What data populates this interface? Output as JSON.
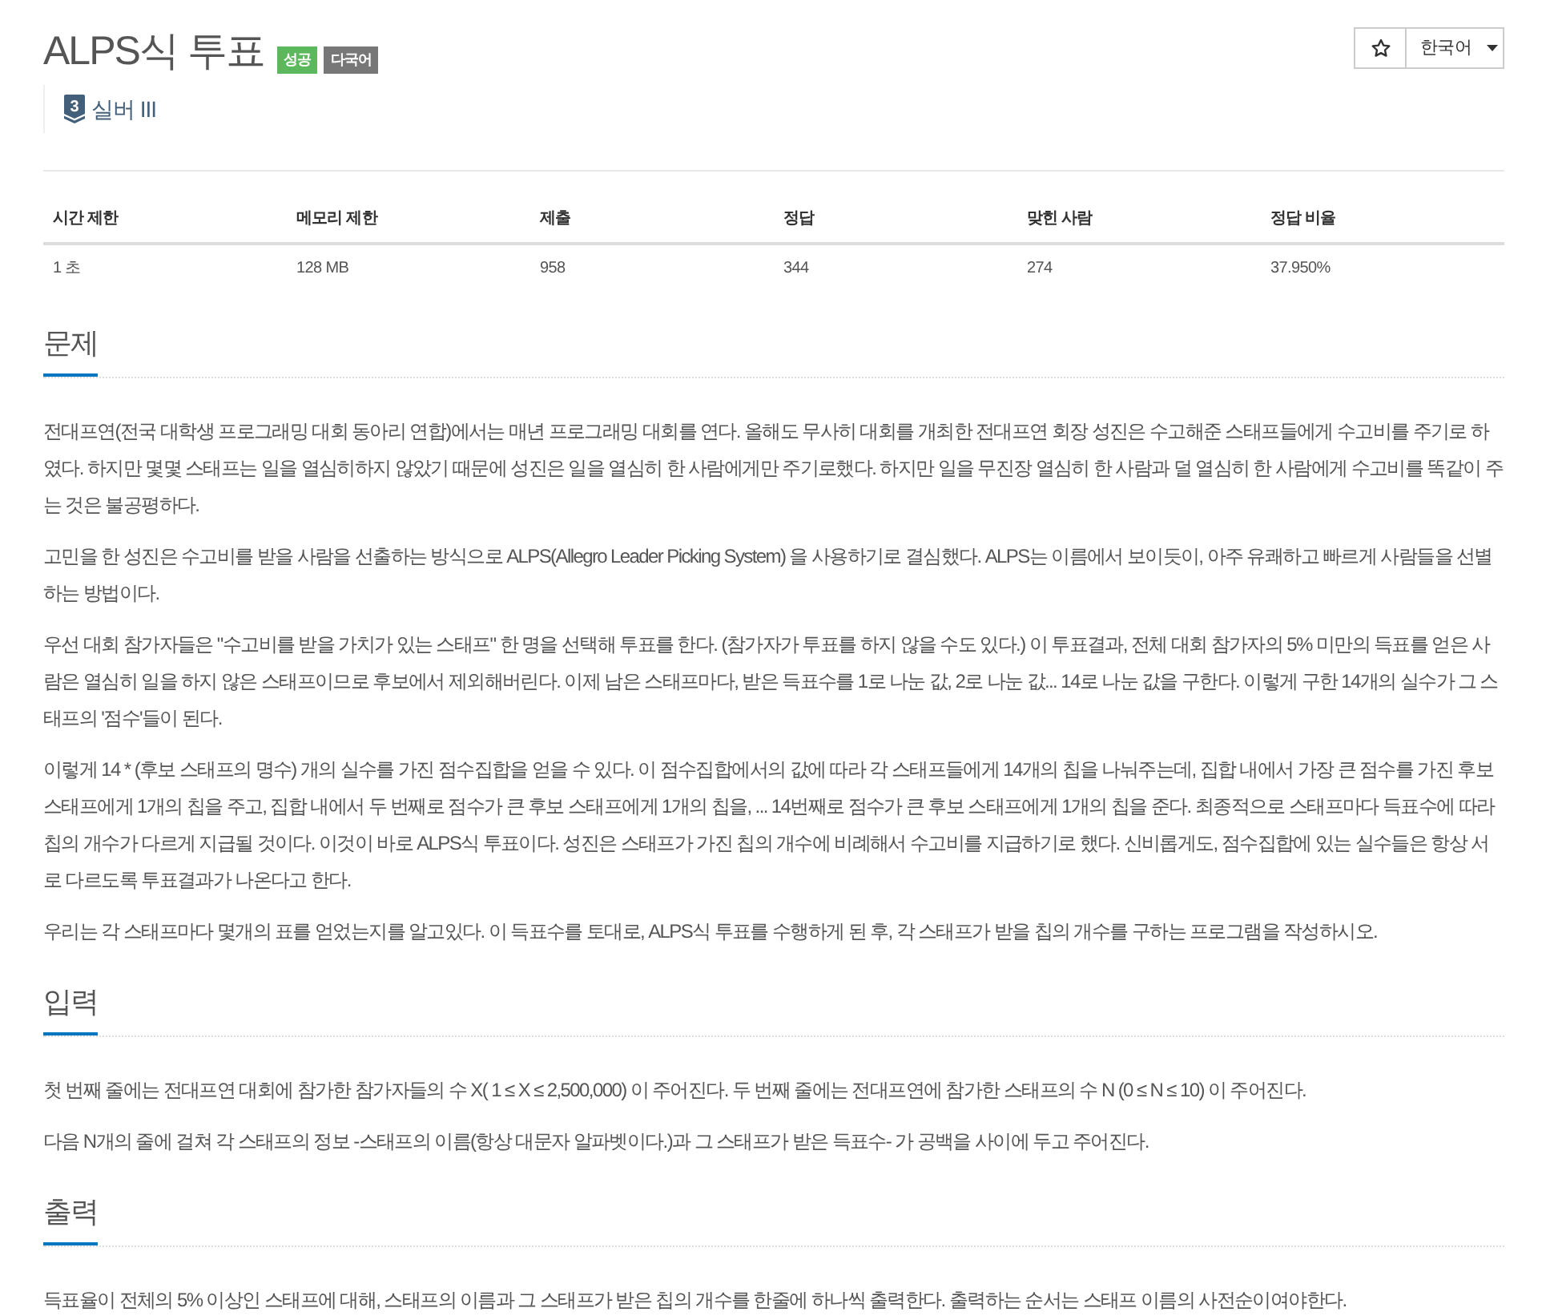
{
  "header": {
    "title": "ALPS식 투표",
    "badges": [
      {
        "label": "성공",
        "kind": "success"
      },
      {
        "label": "다국어",
        "kind": "multilang"
      }
    ],
    "favorite": {
      "starred": false
    },
    "language_menu": {
      "label": "한국어"
    },
    "tier": {
      "number": "3",
      "label": "실버 III"
    }
  },
  "stats_table": {
    "columns": [
      "시간 제한",
      "메모리 제한",
      "제출",
      "정답",
      "맞힌 사람",
      "정답 비율"
    ],
    "rows": [
      [
        "1 초",
        "128 MB",
        "958",
        "344",
        "274",
        "37.950%"
      ]
    ]
  },
  "sections": [
    {
      "title": "문제",
      "paragraphs": [
        "전대프연(전국 대학생 프로그래밍 대회 동아리 연합)에서는 매년 프로그래밍 대회를 연다. 올해도 무사히 대회를 개최한 전대프연 회장 성진은 수고해준 스태프들에게 수고비를 주기로 하였다. 하지만 몇몇 스태프는 일을 열심히하지 않았기 때문에 성진은 일을 열심히 한 사람에게만 주기로했다. 하지만 일을 무진장 열심히 한 사람과 덜 열심히 한 사람에게 수고비를 똑같이 주는 것은 불공평하다.",
        "고민을 한 성진은 수고비를 받을 사람을 선출하는 방식으로 ALPS(Allegro Leader Picking System) 을 사용하기로 결심했다. ALPS는 이름에서 보이듯이, 아주 유쾌하고 빠르게 사람들을 선별하는 방법이다.",
        "우선 대회 참가자들은 \"수고비를 받을 가치가 있는 스태프\" 한 명을 선택해 투표를 한다. (참가자가 투표를 하지 않을 수도 있다.) 이 투표결과, 전체 대회 참가자의 5% 미만의 득표를 얻은 사람은 열심히 일을 하지 않은 스태프이므로 후보에서 제외해버린다. 이제 남은 스태프마다, 받은 득표수를 1로 나눈 값, 2로 나눈 값... 14로 나눈 값을 구한다. 이렇게 구한 14개의 실수가 그 스태프의 '점수'들이 된다.",
        "이렇게 14 * (후보 스태프의 명수) 개의 실수를 가진 점수집합을 얻을 수 있다. 이 점수집합에서의 값에 따라 각 스태프들에게 14개의 칩을 나눠주는데, 집합 내에서 가장 큰 점수를 가진 후보 스태프에게 1개의 칩을 주고, 집합 내에서 두 번째로 점수가 큰 후보 스태프에게 1개의 칩을, ... 14번째로 점수가 큰 후보 스태프에게 1개의 칩을 준다. 최종적으로 스태프마다 득표수에 따라 칩의 개수가 다르게 지급될 것이다. 이것이 바로 ALPS식 투표이다. 성진은 스태프가 가진 칩의 개수에 비례해서 수고비를 지급하기로 했다. 신비롭게도, 점수집합에 있는 실수들은 항상 서로 다르도록 투표결과가 나온다고 한다.",
        "우리는 각 스태프마다 몇개의 표를 얻었는지를 알고있다. 이 득표수를 토대로, ALPS식 투표를 수행하게 된 후, 각 스태프가 받을 칩의 개수를 구하는 프로그램을 작성하시오."
      ]
    },
    {
      "title": "입력",
      "paragraphs": [
        "첫 번째 줄에는 전대프연 대회에 참가한 참가자들의 수 X( 1 ≤ X ≤ 2,500,000) 이 주어진다. 두 번째 줄에는 전대프연에 참가한 스태프의 수 N (0 ≤ N ≤ 10) 이 주어진다.",
        "다음 N개의 줄에 걸쳐 각 스태프의 정보 -스태프의 이름(항상 대문자 알파벳이다.)과 그 스태프가 받은 득표수- 가 공백을 사이에 두고 주어진다."
      ]
    },
    {
      "title": "출력",
      "paragraphs": [
        "득표율이 전체의 5% 이상인 스태프에 대해, 스태프의 이름과 그 스태프가 받은 칩의 개수를 한줄에 하나씩 출력한다. 출력하는 순서는 스태프 이름의 사전순이여야한다."
      ]
    }
  ]
}
